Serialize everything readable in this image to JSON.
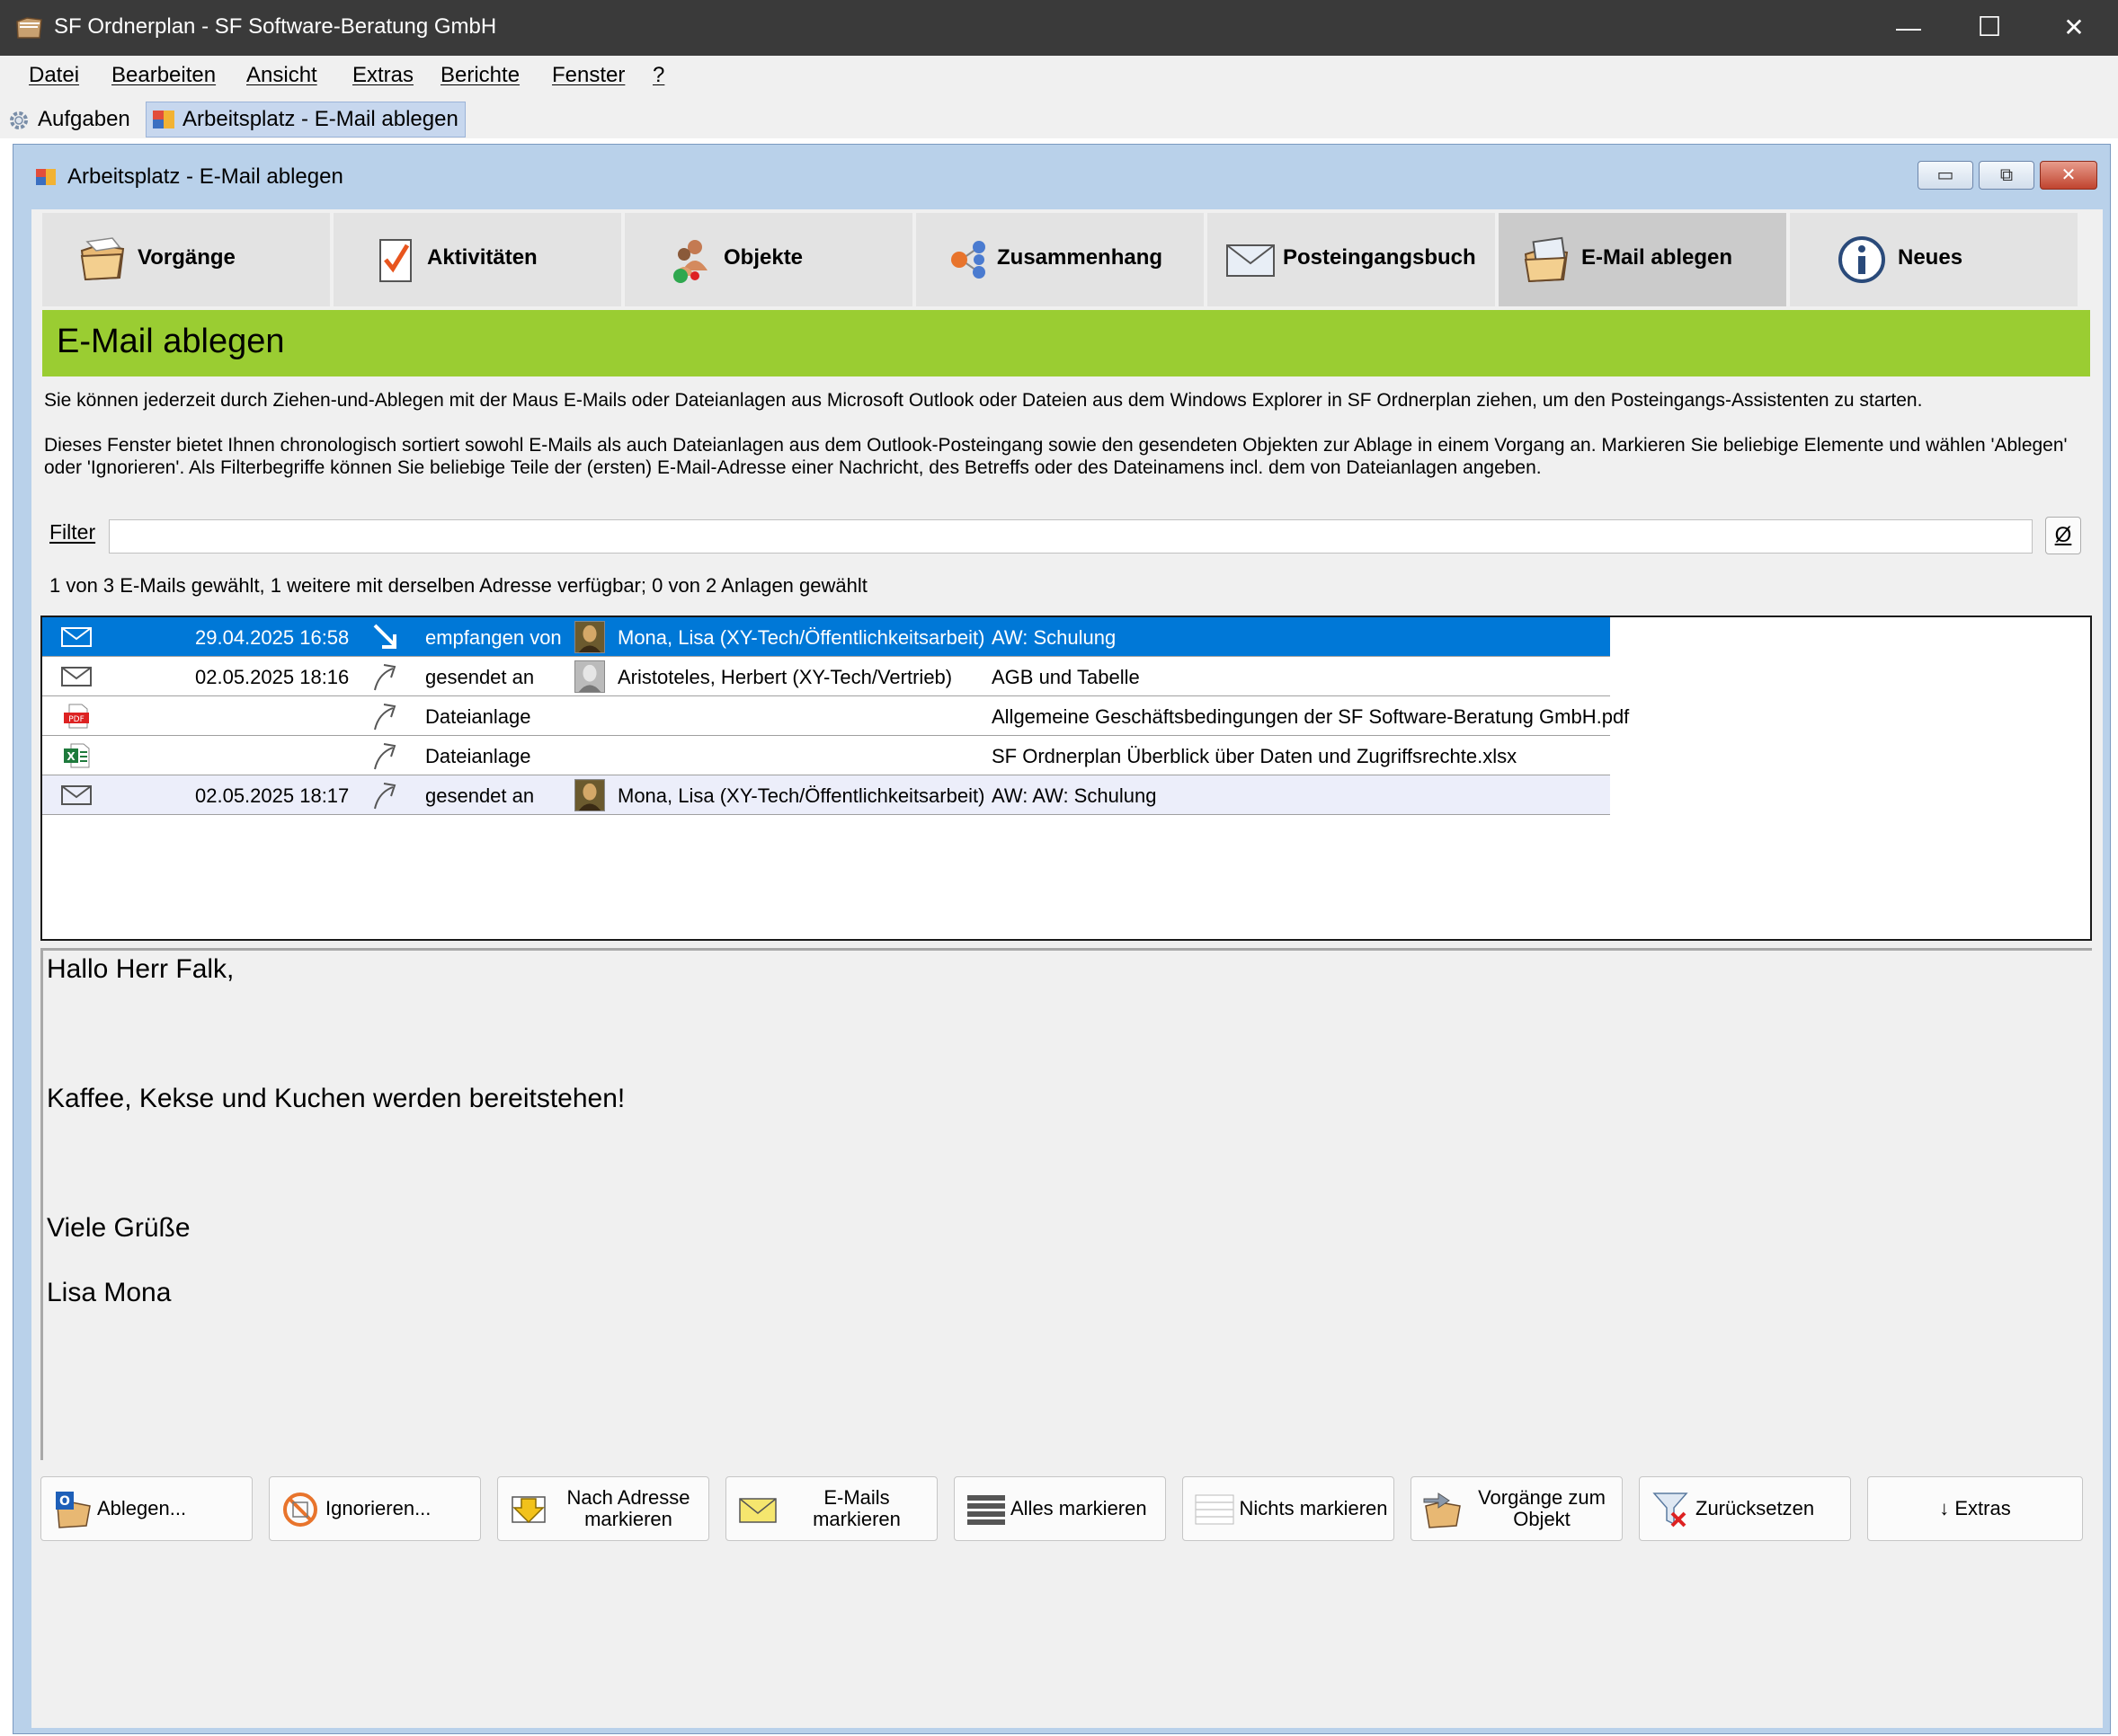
{
  "window": {
    "title": "SF Ordnerplan - SF Software-Beratung GmbH",
    "minimize": "—",
    "maximize": "☐",
    "close": "✕"
  },
  "menu": [
    "Datei",
    "Bearbeiten",
    "Ansicht",
    "Extras",
    "Berichte",
    "Fenster",
    "?"
  ],
  "doc_tabs": {
    "tasks": "Aufgaben",
    "workspace": "Arbeitsplatz - E-Mail ablegen"
  },
  "mdi": {
    "title": "Arbeitsplatz - E-Mail ablegen"
  },
  "nav": [
    {
      "label": "Vorgänge",
      "icon": "folder-icon"
    },
    {
      "label": "Aktivitäten",
      "icon": "checklist-icon"
    },
    {
      "label": "Objekte",
      "icon": "people-icon"
    },
    {
      "label": "Zusammenhang",
      "icon": "network-icon"
    },
    {
      "label": "Posteingangsbuch",
      "icon": "envelope-icon"
    },
    {
      "label": "E-Mail ablegen",
      "icon": "mail-folder-icon",
      "active": true
    },
    {
      "label": "Neues",
      "icon": "info-icon"
    }
  ],
  "header": {
    "title": "E-Mail ablegen",
    "color": "#9acd32"
  },
  "description": {
    "p1": "Sie können jederzeit durch Ziehen-und-Ablegen mit der Maus E-Mails oder Dateianlagen aus Microsoft Outlook oder Dateien aus dem Windows Explorer in SF Ordnerplan ziehen, um den Posteingangs-Assistenten zu starten.",
    "p2": "Dieses Fenster bietet Ihnen chronologisch sortiert sowohl E-Mails als auch Dateianlagen aus dem Outlook-Posteingang sowie den gesendeten Objekten zur Ablage in einem Vorgang an. Markieren Sie beliebige Elemente und wählen 'Ablegen' oder 'Ignorieren'. Als Filterbegriffe können Sie beliebige Teile der (ersten) E-Mail-Adresse einer Nachricht, des Betreffs oder des Dateinamens incl. dem von Dateianlagen angeben."
  },
  "filter": {
    "label": "Filter",
    "value": "",
    "clear": "Ø"
  },
  "status": "1 von 3 E-Mails gewählt, 1 weitere mit derselben Adresse verfügbar; 0 von 2 Anlagen gewählt",
  "rows": [
    {
      "type": "mail",
      "date": "29.04.2025 16:58",
      "direction": "in",
      "action": "empfangen von",
      "person": "Mona, Lisa (XY-Tech/Öffentlichkeitsarbeit)",
      "subject": "AW: Schulung",
      "selected": true
    },
    {
      "type": "mail",
      "date": "02.05.2025 18:16",
      "direction": "out",
      "action": "gesendet an",
      "person": "Aristoteles, Herbert (XY-Tech/Vertrieb)",
      "subject": "AGB und Tabelle"
    },
    {
      "type": "pdf",
      "date": "",
      "direction": "out",
      "action": "Dateianlage",
      "person": "",
      "subject": "Allgemeine Geschäftsbedingungen der SF Software-Beratung GmbH.pdf"
    },
    {
      "type": "xlsx",
      "date": "",
      "direction": "out",
      "action": "Dateianlage",
      "person": "",
      "subject": "SF Ordnerplan Überblick über Daten und Zugriffsrechte.xlsx"
    },
    {
      "type": "mail",
      "date": "02.05.2025 18:17",
      "direction": "out",
      "action": "gesendet an",
      "person": "Mona, Lisa (XY-Tech/Öffentlichkeitsarbeit)",
      "subject": "AW: AW: Schulung",
      "alt": true
    }
  ],
  "preview": {
    "greeting": "Hallo Herr Falk,",
    "body": "Kaffee, Kekse und Kuchen werden bereitstehen!",
    "closing": "Viele Grüße",
    "signature": "Lisa Mona"
  },
  "buttons": [
    {
      "label": "Ablegen...",
      "icon": "outlook-folder-icon"
    },
    {
      "label": "Ignorieren...",
      "icon": "forbidden-icon"
    },
    {
      "label": "Nach Adresse markieren",
      "icon": "arrow-down-icon"
    },
    {
      "label": "E-Mails markieren",
      "icon": "envelope-icon"
    },
    {
      "label": "Alles markieren",
      "icon": "lines-filled-icon"
    },
    {
      "label": "Nichts markieren",
      "icon": "lines-empty-icon"
    },
    {
      "label": "Vorgänge zum Objekt",
      "icon": "folder-arrow-icon"
    },
    {
      "label": "Zurücksetzen",
      "icon": "filter-reset-icon"
    },
    {
      "label": "↓ Extras",
      "icon": ""
    }
  ]
}
